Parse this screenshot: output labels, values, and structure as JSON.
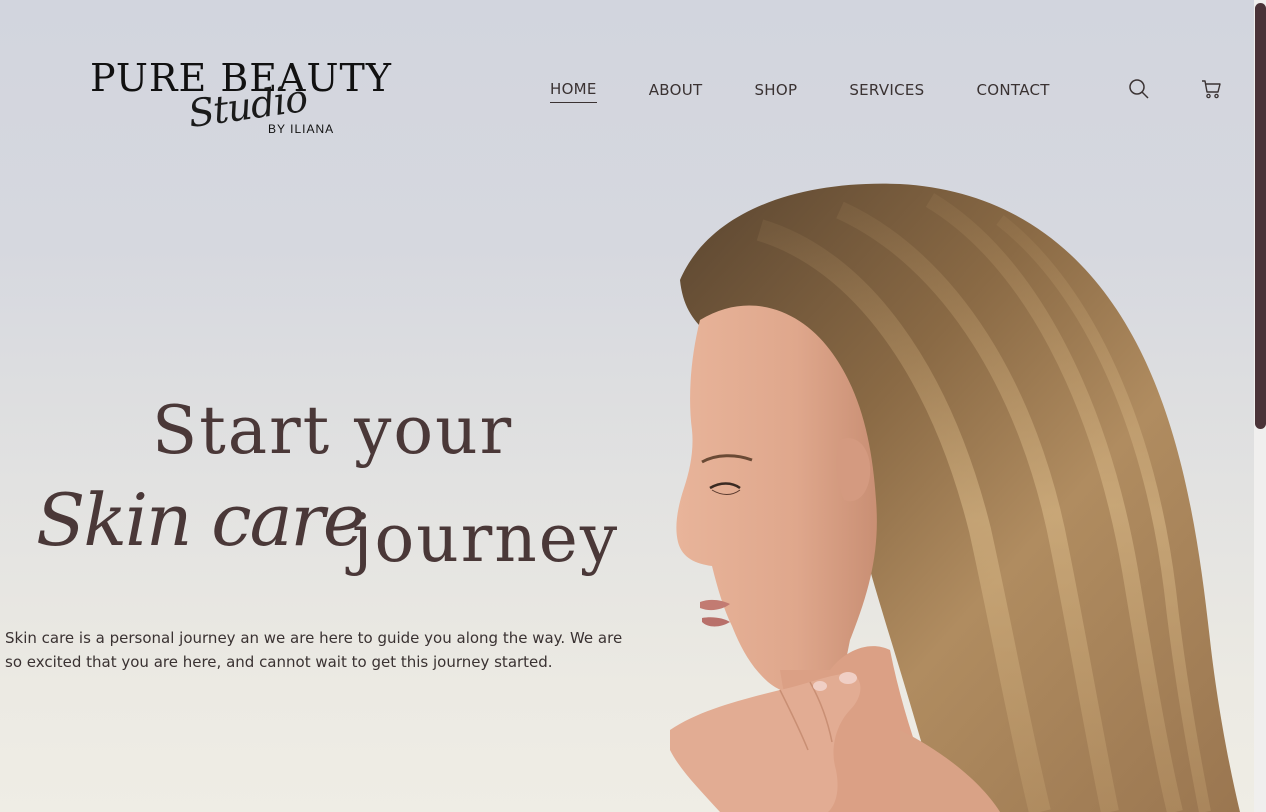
{
  "logo": {
    "main": "PURE BEAUTY",
    "script": "Studio",
    "sub": "BY ILIANA"
  },
  "nav": {
    "items": [
      {
        "label": "HOME",
        "active": true
      },
      {
        "label": "ABOUT",
        "active": false
      },
      {
        "label": "SHOP",
        "active": false
      },
      {
        "label": "SERVICES",
        "active": false
      },
      {
        "label": "CONTACT",
        "active": false
      }
    ],
    "icons": [
      "search-icon",
      "cart-icon"
    ]
  },
  "hero": {
    "line1": "Start your",
    "script": "Skin care",
    "line2": "journey",
    "body": "Skin care is a personal journey an we are here to guide you along the way. We are so excited that you are here, and cannot wait to get this journey started."
  },
  "colors": {
    "text": "#3a3232",
    "heading": "#4a3838",
    "scroll_thumb": "#4a3338"
  }
}
